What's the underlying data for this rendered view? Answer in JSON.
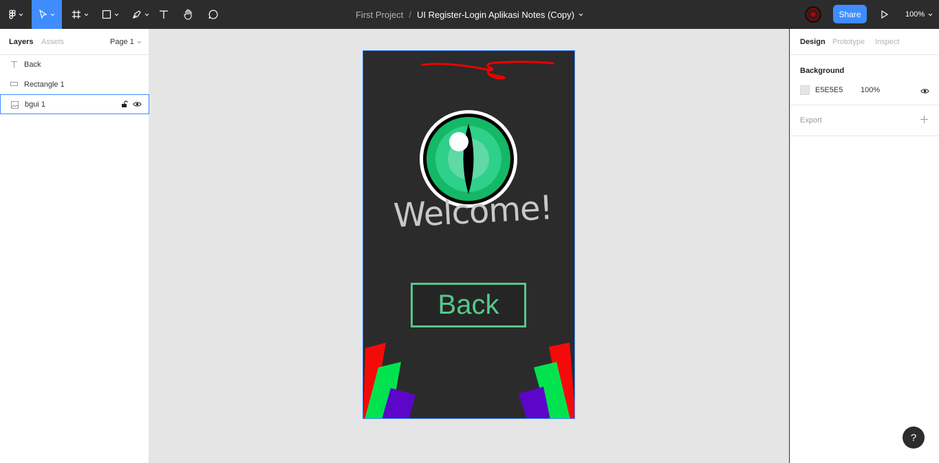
{
  "toolbar": {
    "project": "First Project",
    "separator": "/",
    "file_name": "UI Register-Login Aplikasi Notes (Copy)",
    "share_label": "Share",
    "zoom": "100%"
  },
  "left_panel": {
    "tabs": {
      "layers": "Layers",
      "assets": "Assets"
    },
    "page": "Page 1",
    "layers": [
      {
        "name": "Back",
        "icon": "text-icon"
      },
      {
        "name": "Rectangle 1",
        "icon": "rectangle-icon"
      },
      {
        "name": "bgui 1",
        "icon": "image-icon"
      }
    ]
  },
  "canvas": {
    "frame": {
      "welcome_text": "Welcome!",
      "back_button": "Back"
    }
  },
  "right_panel": {
    "tabs": {
      "design": "Design",
      "prototype": "Prototype",
      "inspect": "Inspect"
    },
    "background_title": "Background",
    "background_hex": "E5E5E5",
    "background_opacity": "100%",
    "export_label": "Export"
  },
  "help_label": "?",
  "colors": {
    "accent": "#3f8cff",
    "toolbar_bg": "#2c2c2c",
    "canvas_bg": "#e5e5e5",
    "frame_bg": "#2b2b2b",
    "green": "#55c98a"
  }
}
